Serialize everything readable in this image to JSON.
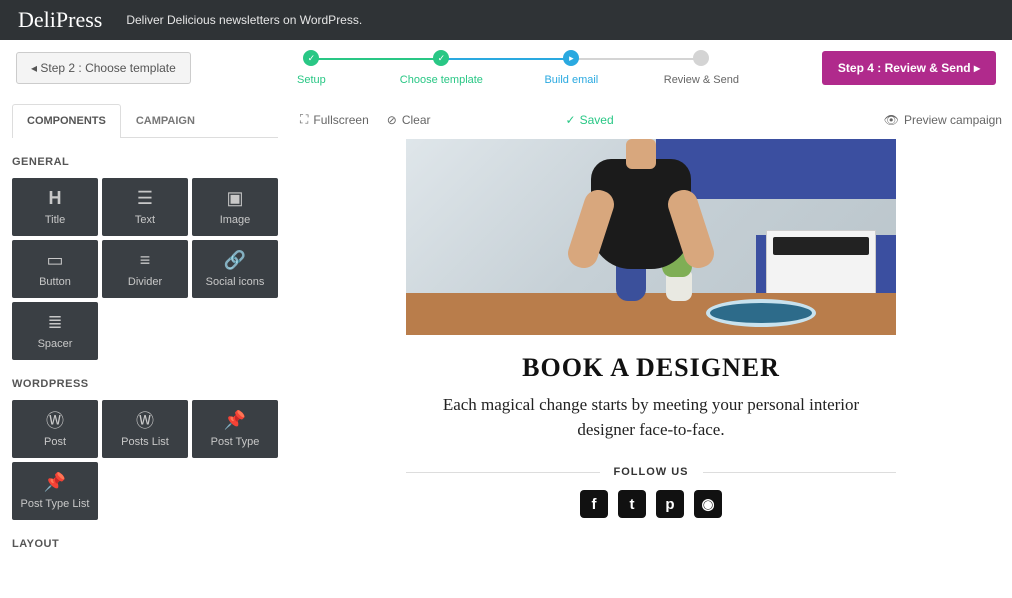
{
  "header": {
    "brand": "DeliPress",
    "tagline": "Deliver Delicious newsletters on WordPress.",
    "back_button": "Step 2 : Choose template",
    "forward_button": "Step 4 : Review & Send"
  },
  "stepper": {
    "steps": [
      {
        "label": "Setup",
        "state": "done"
      },
      {
        "label": "Choose template",
        "state": "done"
      },
      {
        "label": "Build email",
        "state": "current"
      },
      {
        "label": "Review & Send",
        "state": "todo"
      }
    ]
  },
  "sidebar": {
    "tabs": {
      "components": "COMPONENTS",
      "campaign": "CAMPAIGN"
    },
    "sections": {
      "general": {
        "title": "GENERAL",
        "tiles": [
          "Title",
          "Text",
          "Image",
          "Button",
          "Divider",
          "Social icons",
          "Spacer"
        ]
      },
      "wordpress": {
        "title": "WORDPRESS",
        "tiles": [
          "Post",
          "Posts List",
          "Post Type",
          "Post Type List"
        ]
      },
      "layout": {
        "title": "LAYOUT"
      }
    }
  },
  "canvas_toolbar": {
    "fullscreen": "Fullscreen",
    "clear": "Clear",
    "saved": "Saved",
    "preview": "Preview campaign"
  },
  "email": {
    "heading": "BOOK A DESIGNER",
    "body": "Each magical change starts by meeting your personal interior designer face-to-face.",
    "follow_label": "FOLLOW US",
    "socials": [
      "facebook",
      "twitter",
      "pinterest",
      "instagram"
    ]
  }
}
